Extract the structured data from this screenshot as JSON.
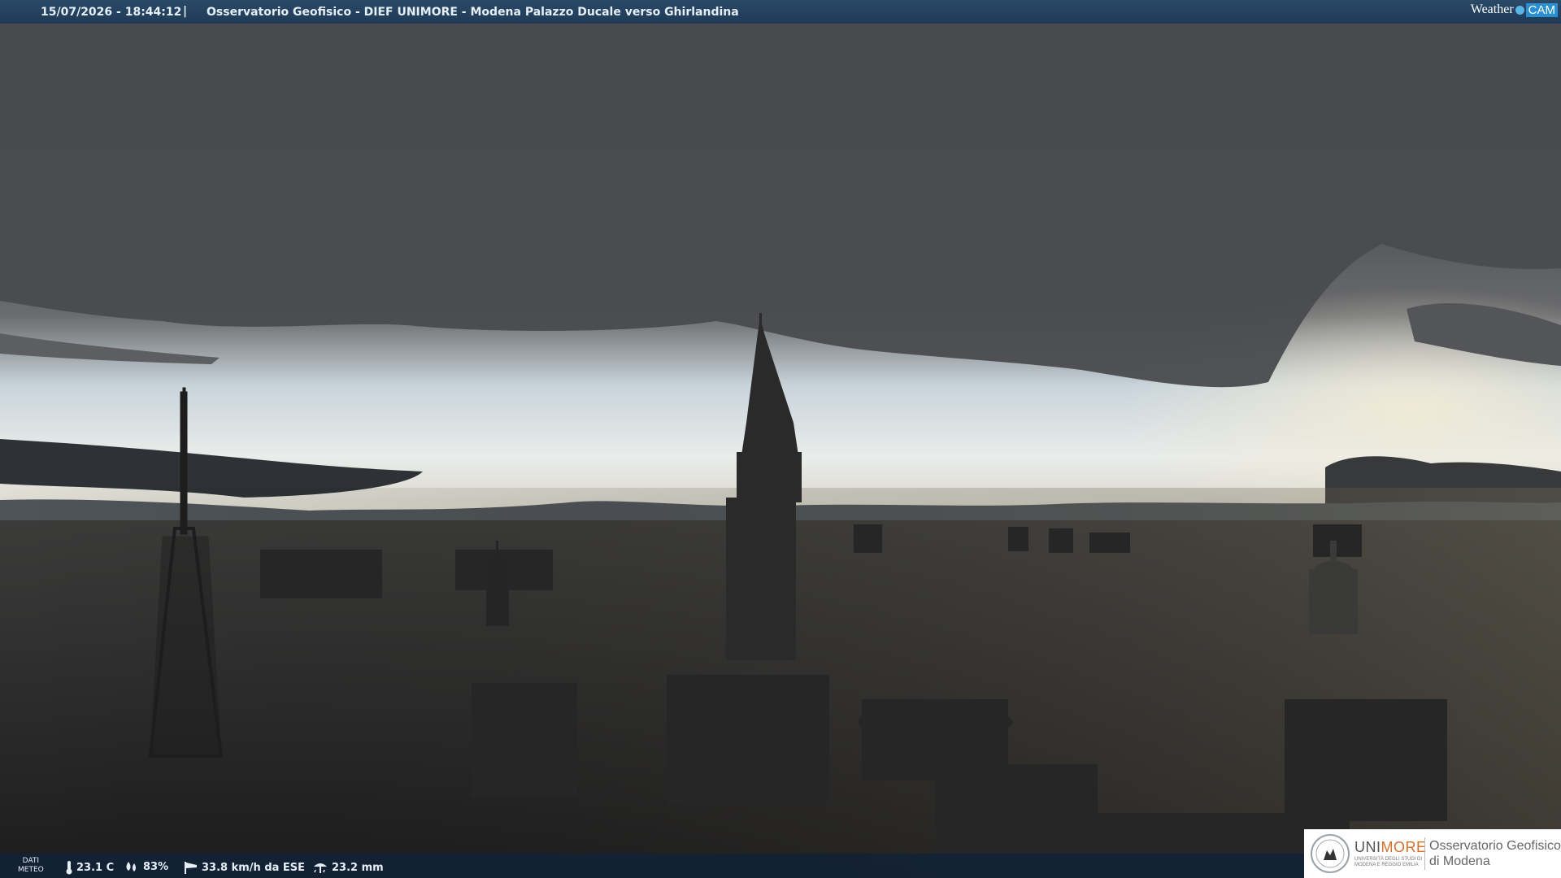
{
  "topbar": {
    "timestamp": "15/07/2026 - 18:44:12",
    "separator": "|",
    "title": "Osservatorio Geofisico - DIEF UNIMORE - Modena Palazzo Ducale verso Ghirlandina"
  },
  "brand": {
    "weather": "Weather",
    "cam": "CAM"
  },
  "meteo": {
    "label_line1": "DATI",
    "label_line2": "METEO",
    "temperature": "23.1 C",
    "humidity": "83%",
    "wind": "33.8 km/h da ESE",
    "rain": "23.2 mm"
  },
  "logo": {
    "uni_part1": "UNI",
    "uni_part2": "MORE",
    "uni_sub": "UNIVERSITÀ DEGLI STUDI DI MODENA E REGGIO EMILIA",
    "obs_line1": "Osservatorio Geofisico",
    "obs_line2": "di Modena"
  },
  "colors": {
    "accent_orange": "#d4702a",
    "bar_blue": "#1e3a57"
  },
  "icons": [
    "thermometer-icon",
    "humidity-drops-icon",
    "wind-sock-icon",
    "rain-gauge-icon"
  ]
}
